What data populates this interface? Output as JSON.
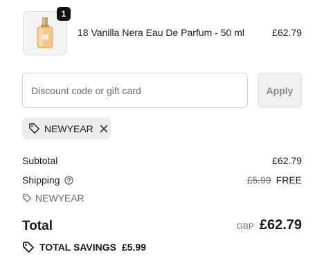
{
  "product": {
    "quantity": "1",
    "name": "18 Vanilla Nera Eau De Parfum - 50 ml",
    "price": "£62.79",
    "image_icon": "perfume-bottle-icon"
  },
  "discount": {
    "placeholder": "Discount code or gift card",
    "apply_label": "Apply",
    "applied_code": "NEWYEAR"
  },
  "summary": {
    "subtotal_label": "Subtotal",
    "subtotal_value": "£62.79",
    "shipping_label": "Shipping",
    "shipping_original": "£5.99",
    "shipping_value": "FREE",
    "discount_code": "NEWYEAR",
    "total_label": "Total",
    "currency": "GBP",
    "total_value": "£62.79",
    "savings_label": "TOTAL SAVINGS",
    "savings_value": "£5.99"
  },
  "colors": {
    "text": "#1a1a1a",
    "muted": "#6b6b6b",
    "chip_bg": "#ececec",
    "apply_bg": "#f0f0f0"
  }
}
